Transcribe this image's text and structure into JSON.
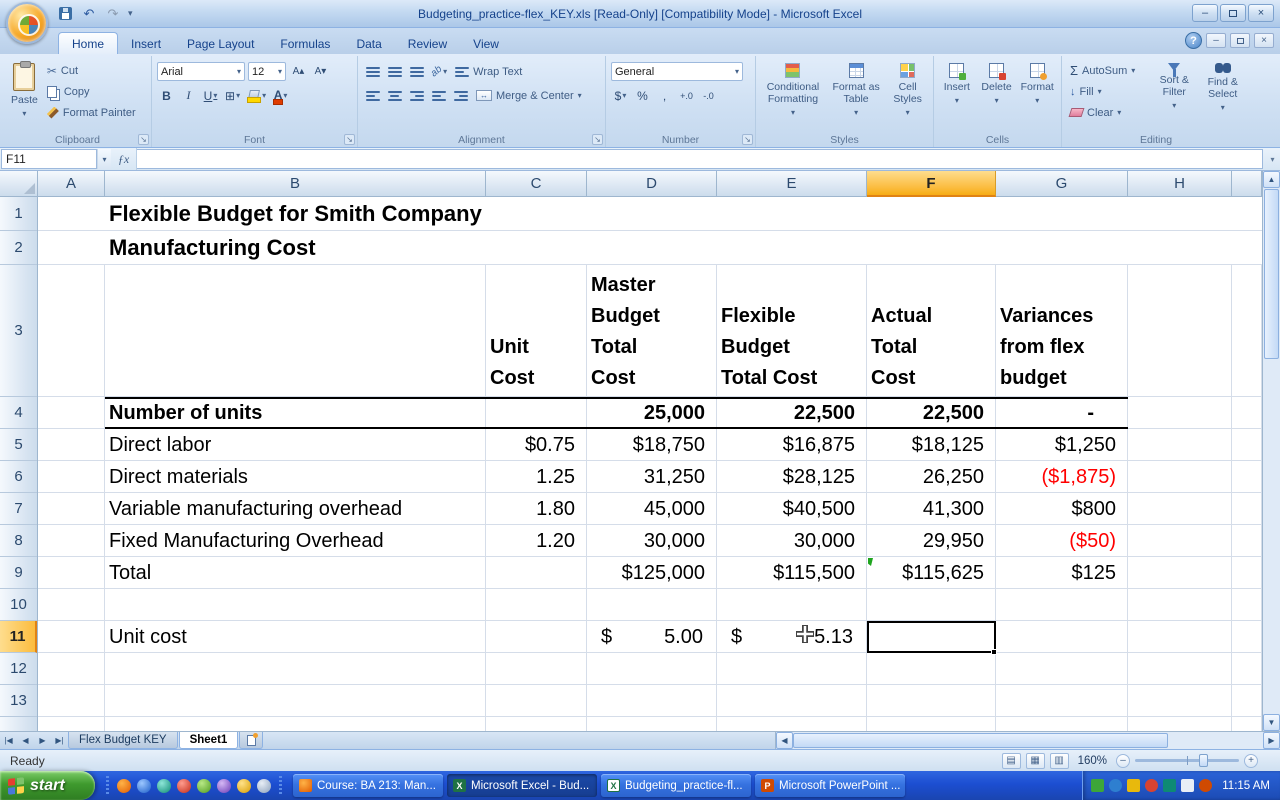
{
  "titlebar": {
    "title": "Budgeting_practice-flex_KEY.xls  [Read-Only]  [Compatibility Mode] - Microsoft Excel"
  },
  "colors": {
    "negative_value": "#ff0000",
    "selected_header": "#fbbc3e",
    "selection_border": "#000000",
    "taskbar": "#1c4ed1",
    "start_green": "#3f9a2e"
  },
  "icons": {
    "dropdown": "▾",
    "undo": "↶",
    "redo": "↷",
    "cut": "✂",
    "launcher": "↘",
    "borders": "⊞",
    "font_color_a": "A",
    "grow_font": "A▴",
    "shrink_font": "A▾",
    "bold": "B",
    "italic": "I",
    "underline": "U",
    "orientation": "ab",
    "merge_arrows": "↔",
    "dollar": "$",
    "percent": "%",
    "comma": ",",
    "increase_decimal": "+.0",
    "decrease_decimal": "-.0",
    "sigma": "Σ",
    "fill_arrow": "↓",
    "help": "?",
    "minimize": "–",
    "close": "×",
    "fx": "ƒx",
    "tab_first": "|◀",
    "tab_prev": "◀",
    "tab_next": "▶",
    "tab_last": "▶|",
    "scroll_up": "▲",
    "scroll_down": "▼",
    "scroll_left": "◀",
    "scroll_right": "▶",
    "view_normal": "▤",
    "view_layout": "▦",
    "view_break": "▥",
    "zoom_out": "–",
    "zoom_in": "+"
  },
  "ribbon": {
    "tabs": [
      {
        "label": "Home"
      },
      {
        "label": "Insert"
      },
      {
        "label": "Page Layout"
      },
      {
        "label": "Formulas"
      },
      {
        "label": "Data"
      },
      {
        "label": "Review"
      },
      {
        "label": "View"
      }
    ],
    "clipboard": {
      "label": "Clipboard",
      "paste": "Paste",
      "cut": "Cut",
      "copy": "Copy",
      "format_painter": "Format Painter"
    },
    "font": {
      "label": "Font",
      "name": "Arial",
      "size": "12"
    },
    "alignment": {
      "label": "Alignment",
      "wrap_text": "Wrap Text",
      "merge_center": "Merge & Center"
    },
    "number": {
      "label": "Number",
      "format": "General"
    },
    "styles": {
      "label": "Styles",
      "conditional": "Conditional Formatting",
      "format_table": "Format as Table",
      "cell_styles": "Cell Styles"
    },
    "cells": {
      "label": "Cells",
      "insert": "Insert",
      "delete": "Delete",
      "format": "Format"
    },
    "editing": {
      "label": "Editing",
      "autosum": "AutoSum",
      "fill": "Fill",
      "clear": "Clear",
      "sort_filter": "Sort & Filter",
      "find_select": "Find & Select"
    }
  },
  "formula_bar": {
    "name_box": "F11",
    "formula": ""
  },
  "sheet": {
    "columns": [
      "A",
      "B",
      "C",
      "D",
      "E",
      "F",
      "G",
      "H"
    ],
    "rows": [
      "1",
      "2",
      "3",
      "4",
      "5",
      "6",
      "7",
      "8",
      "9",
      "10",
      "11",
      "12",
      "13"
    ],
    "active_cell": "F11",
    "title_line1": "Flexible Budget for Smith Company",
    "title_line2": "Manufacturing Cost",
    "headers": {
      "c": "Unit\nCost",
      "d": "Master\nBudget\nTotal\nCost",
      "e": "Flexible\nBudget\nTotal Cost",
      "f": "Actual\nTotal\nCost",
      "g": "Variances\nfrom flex\nbudget"
    },
    "data_rows": [
      {
        "b": "Number of units",
        "c": "",
        "d": "25,000",
        "e": "22,500",
        "f": "22,500",
        "g": "-"
      },
      {
        "b": "Direct labor",
        "c": "$0.75",
        "d": "$18,750",
        "e": "$16,875",
        "f": "$18,125",
        "g": "$1,250"
      },
      {
        "b": "Direct materials",
        "c": "1.25",
        "d": "31,250",
        "e": "$28,125",
        "f": "26,250",
        "g": "($1,875)"
      },
      {
        "b": "Variable manufacturing overhead",
        "c": "1.80",
        "d": "45,000",
        "e": "$40,500",
        "f": "41,300",
        "g": "$800"
      },
      {
        "b": "Fixed Manufacturing Overhead",
        "c": "1.20",
        "d": "30,000",
        "e": "30,000",
        "f": "29,950",
        "g": "($50)"
      },
      {
        "b": "Total",
        "c": "",
        "d": "$125,000",
        "e": "$115,500",
        "f": "$115,625",
        "g": "$125"
      }
    ],
    "unit_cost": {
      "b": "Unit cost",
      "d_symbol": "$",
      "d_value": "5.00",
      "e_symbol": "$",
      "e_value": "5.13"
    }
  },
  "sheet_tabs": {
    "tabs": [
      {
        "label": "Flex Budget KEY"
      },
      {
        "label": "Sheet1"
      }
    ]
  },
  "status_bar": {
    "mode": "Ready",
    "zoom": "160%"
  },
  "taskbar": {
    "start_label": "start",
    "windows": [
      {
        "label": "Course: BA 213: Man..."
      },
      {
        "label": "Microsoft Excel - Bud..."
      },
      {
        "label": "Budgeting_practice-fl..."
      },
      {
        "label": "Microsoft PowerPoint ..."
      }
    ],
    "clock": "11:15 AM"
  }
}
